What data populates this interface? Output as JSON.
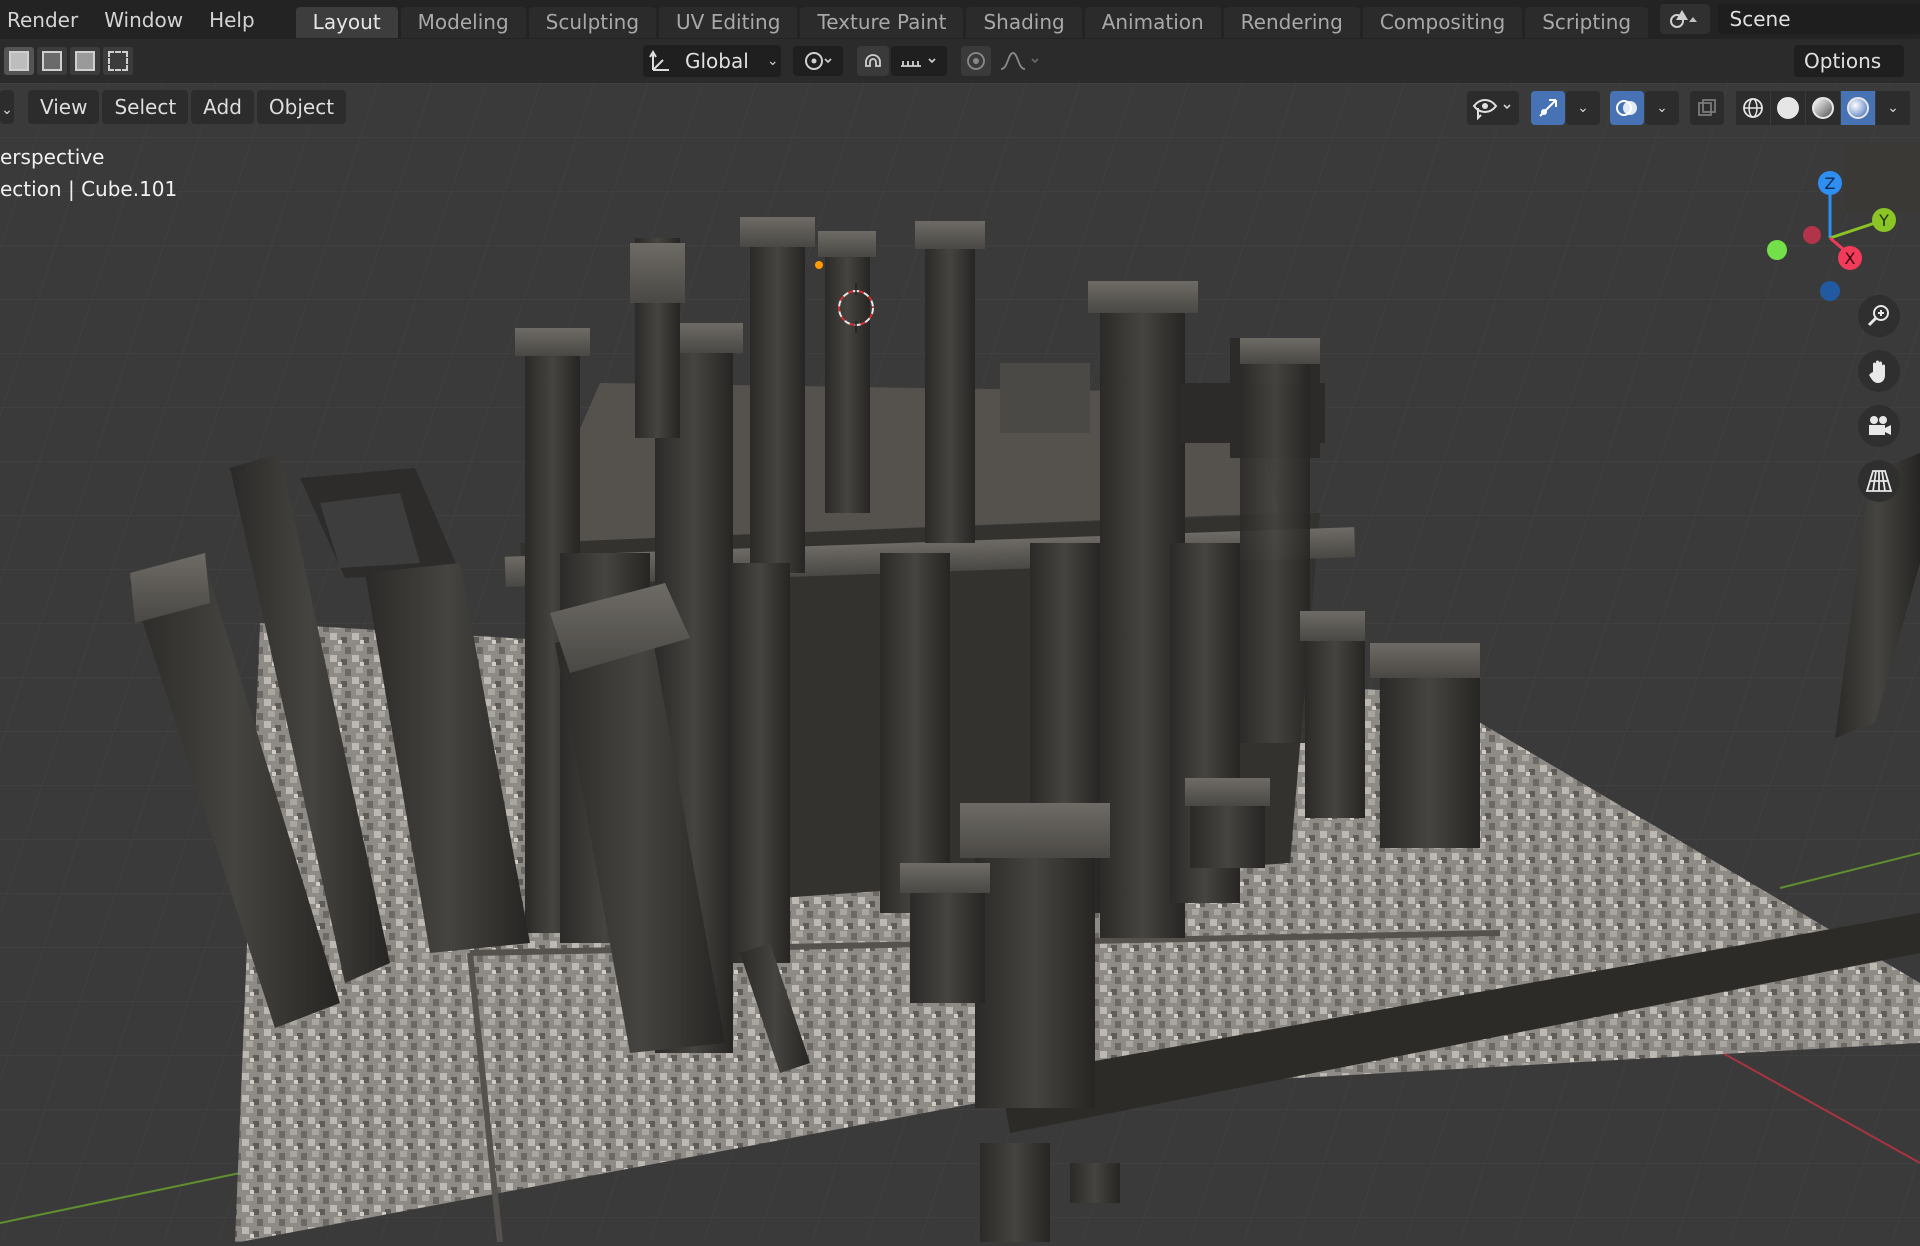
{
  "menu": {
    "items": [
      "Render",
      "Window",
      "Help"
    ]
  },
  "workspaces": {
    "tabs": [
      "Layout",
      "Modeling",
      "Sculpting",
      "UV Editing",
      "Texture Paint",
      "Shading",
      "Animation",
      "Rendering",
      "Compositing",
      "Scripting"
    ],
    "active": "Layout",
    "add_label": "+"
  },
  "scene": {
    "name": "Scene"
  },
  "tool_header": {
    "transform_orientation": "Global",
    "options_label": "Options"
  },
  "viewport_header": {
    "menus": [
      "View",
      "Select",
      "Add",
      "Object"
    ]
  },
  "viewport_info": {
    "view_name": "erspective",
    "collection_line": "ection | Cube.101"
  },
  "gizmo": {
    "axes": {
      "z": "Z",
      "y": "Y",
      "x": "X"
    },
    "colors": {
      "z": "#2e8ef1",
      "y": "#8bc425",
      "x": "#f13b5a",
      "neg_y": "#73e04a",
      "neg_x": "#c8344f",
      "neg_z": "#215aa1"
    }
  },
  "icons": {
    "nav": [
      "zoom-icon",
      "hand-pan-icon",
      "camera-icon",
      "grid-perspective-icon"
    ]
  },
  "colors": {
    "accent": "#4772b3",
    "topbar": "#232323",
    "viewport_bg": "#3a3a3a"
  }
}
